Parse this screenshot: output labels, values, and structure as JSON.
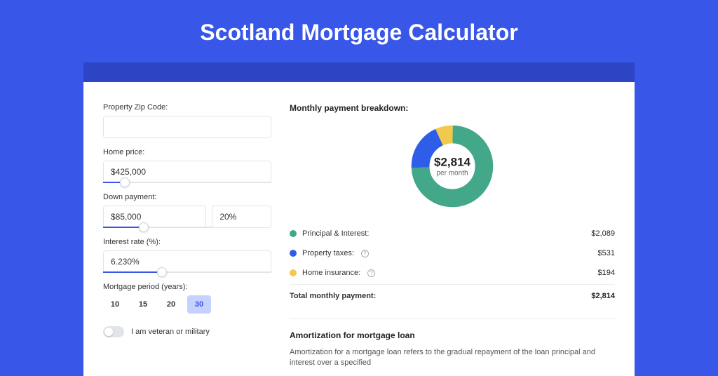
{
  "title": "Scotland Mortgage Calculator",
  "form": {
    "zip": {
      "label": "Property Zip Code:",
      "value": ""
    },
    "home_price": {
      "label": "Home price:",
      "value": "$425,000",
      "slider_percent": 10
    },
    "down_payment": {
      "label": "Down payment:",
      "amount": "$85,000",
      "percent": "20%",
      "slider_percent": 22
    },
    "interest_rate": {
      "label": "Interest rate (%):",
      "value": "6.230%",
      "slider_percent": 32
    },
    "period": {
      "label": "Mortgage period (years):",
      "options": [
        "10",
        "15",
        "20",
        "30"
      ],
      "selected": "30"
    },
    "veteran": {
      "label": "I am veteran or military",
      "on": false
    }
  },
  "breakdown": {
    "title": "Monthly payment breakdown:",
    "center_value": "$2,814",
    "center_label": "per month",
    "items": [
      {
        "label": "Principal & Interest:",
        "value": "$2,089",
        "color": "#43a889",
        "info": false
      },
      {
        "label": "Property taxes:",
        "value": "$531",
        "color": "#2e5de8",
        "info": true
      },
      {
        "label": "Home insurance:",
        "value": "$194",
        "color": "#f2c94c",
        "info": true
      }
    ],
    "total": {
      "label": "Total monthly payment:",
      "value": "$2,814"
    }
  },
  "chart_data": {
    "type": "pie",
    "title": "Monthly payment breakdown",
    "series": [
      {
        "name": "Principal & Interest",
        "value": 2089,
        "color": "#43a889"
      },
      {
        "name": "Property taxes",
        "value": 531,
        "color": "#2e5de8"
      },
      {
        "name": "Home insurance",
        "value": 194,
        "color": "#f2c94c"
      }
    ],
    "total": 2814,
    "center_label": "$2,814 per month"
  },
  "amortization": {
    "title": "Amortization for mortgage loan",
    "text": "Amortization for a mortgage loan refers to the gradual repayment of the loan principal and interest over a specified"
  }
}
